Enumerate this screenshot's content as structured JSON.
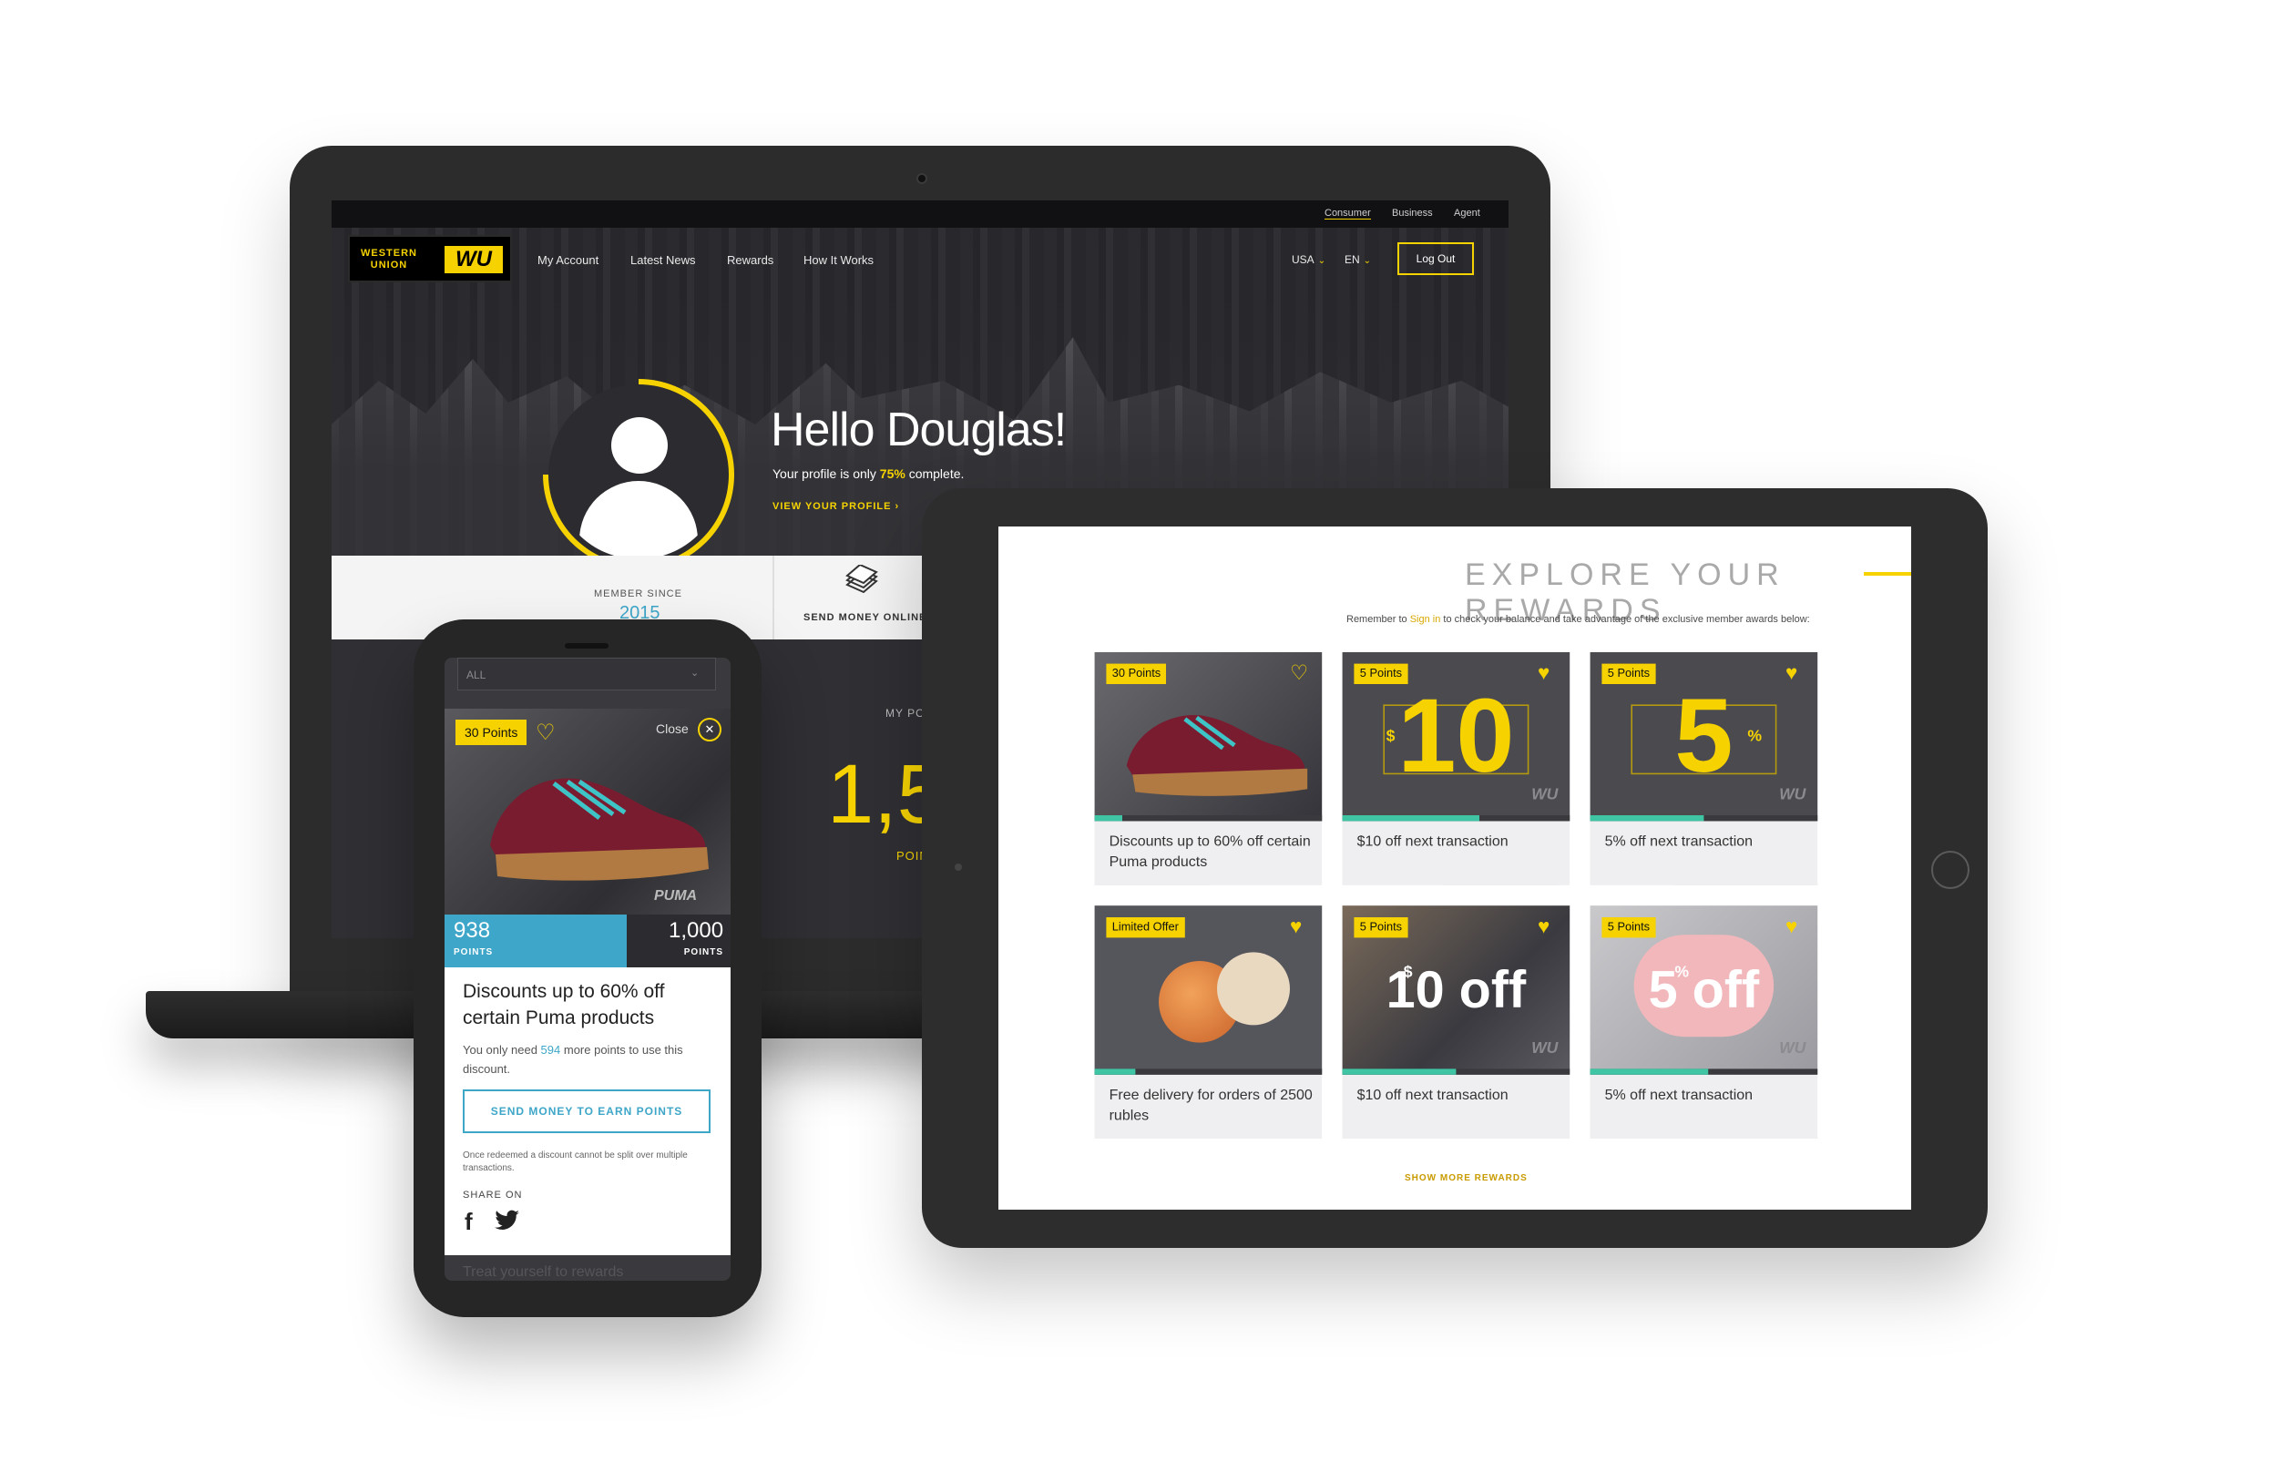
{
  "laptop": {
    "top_links": [
      "Consumer",
      "Business",
      "Agent"
    ],
    "logo": {
      "text": "WESTERN UNION",
      "mark": "WU"
    },
    "nav": [
      "My Account",
      "Latest News",
      "Rewards",
      "How It Works"
    ],
    "country": "USA",
    "language": "EN",
    "logout_label": "Log Out",
    "greeting": "Hello Douglas!",
    "profile_prefix": "Your profile is only ",
    "profile_percent": "75%",
    "profile_suffix": " complete.",
    "profile_completion": 0.75,
    "view_profile": "VIEW YOUR PROFILE ›",
    "member_since_label": "MEMBER SINCE",
    "member_since_year": "2015",
    "send_money_label": "SEND MONEY ONLINE",
    "my_points_label": "MY PO",
    "points_value": "1,5",
    "points_unit": "POIN"
  },
  "tablet": {
    "title": "EXPLORE YOUR REWARDS",
    "remember_prefix": "Remember to ",
    "remember_link": "Sign in",
    "remember_suffix": " to check your balance and take advantage of the exclusive member awards below:",
    "cards": [
      {
        "badge": "30 Points",
        "caption": "Discounts up to 60% off certain Puma products",
        "progress": 0.12,
        "art": "sneaker"
      },
      {
        "badge": "5 Points",
        "caption": "$10 off next transaction",
        "progress": 0.6,
        "art": "ten",
        "big": "10",
        "small": "$",
        "mark": "WU"
      },
      {
        "badge": "5 Points",
        "caption": "5% off next transaction",
        "progress": 0.5,
        "art": "five",
        "big": "5",
        "small": "%",
        "mark": "WU"
      },
      {
        "badge": "Limited Offer",
        "caption": "Free delivery for orders of 2500 rubles",
        "progress": 0.18,
        "art": "cream"
      },
      {
        "badge": "5 Points",
        "caption": "$10 off next transaction",
        "progress": 0.5,
        "art": "ten-off",
        "big": "10 off",
        "small": "$",
        "mark": "WU"
      },
      {
        "badge": "5 Points",
        "caption": "5% off next transaction",
        "progress": 0.52,
        "art": "five-off",
        "big": "5 off",
        "small": "%",
        "mark": "WU"
      }
    ],
    "show_more": "SHOW MORE REWARDS"
  },
  "phone": {
    "filter": "ALL",
    "badge": "30 Points",
    "close_label": "Close",
    "points_have": "938",
    "points_need": "1,000",
    "points_unit": "POINTS",
    "title": "Discounts up to 60% off certain Puma products",
    "desc_prefix": "You only need ",
    "desc_points": "594",
    "desc_suffix": " more points to use this discount.",
    "cta": "SEND MONEY TO EARN POINTS",
    "note": "Once redeemed a discount cannot be split over multiple transactions.",
    "share_label": "SHARE ON",
    "peek": "Treat yourself to rewards"
  },
  "colors": {
    "brand_yellow": "#f6d300",
    "accent_blue": "#3ea6c8",
    "progress_green": "#3fc5a4"
  }
}
